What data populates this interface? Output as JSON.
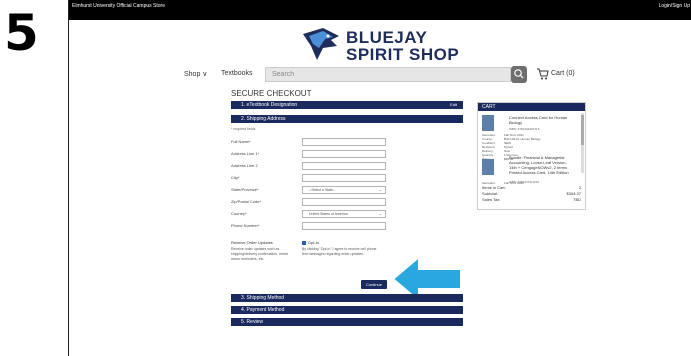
{
  "step_number": "5",
  "topbar": {
    "store": "Elmhurst University Official Campus Store",
    "login": "Login/Sign Up"
  },
  "logo": {
    "line1": "BLUEJAY",
    "line2": "SPIRIT SHOP"
  },
  "nav": {
    "shop": "Shop ∨",
    "textbooks": "Textbooks",
    "search_placeholder": "Search",
    "cart": "Cart (0)"
  },
  "page_title": "SECURE CHECKOUT",
  "sections": {
    "s1": "1. eTextbook Designation",
    "s1_edit": "Edit",
    "s2": "2. Shipping Address",
    "s3": "3. Shipping Method",
    "s4": "4. Payment Method",
    "s5": "5. Review"
  },
  "form": {
    "required_note": "* required fields",
    "fields": [
      {
        "label": "Full Name*",
        "value": ""
      },
      {
        "label": "Address Line 1*",
        "value": ""
      },
      {
        "label": "Address Line 2",
        "value": ""
      },
      {
        "label": "City*",
        "value": ""
      },
      {
        "label": "State/Province*",
        "value": "--Select a State--"
      },
      {
        "label": "Zip/Postal Code*",
        "value": ""
      },
      {
        "label": "Country*",
        "value": "United States of America"
      },
      {
        "label": "Phone Number*",
        "value": ""
      }
    ],
    "updates_title": "Receive Order Updates",
    "updates_desc": "Receive order updates such as shipping/delivery confirmation, rental return reminders, etc.",
    "optin_label": "Opt-in",
    "consent": "By clicking \"Opt-in\" I agree to receive cell phone text messages regarding order updates.",
    "continue": "Continue"
  },
  "cart": {
    "heading": "CART",
    "items": [
      {
        "name": "Connect Access Card for Human Biology",
        "isbn": "ISBN: 9781264462715",
        "meta": [
          [
            "Semester:",
            "Fall Term 2021"
          ],
          [
            "Course:",
            "BIO-100-01 Human Biology"
          ],
          [
            "Condition:",
            "NEW"
          ],
          [
            "Recipient:",
            "Myself"
          ],
          [
            "Delivery:",
            "Now"
          ],
          [
            "Quantity:",
            "1 Remove"
          ],
          [
            "Price:",
            "$68.40"
          ]
        ]
      },
      {
        "name": "Bundle: Financial & Managerial Accounting, Loose-Leaf Version, 14th + CengageNOWv2, 2 terms Printed Access Card, 14th Edition",
        "isbn": "ISBN: 9781337911610",
        "meta": [
          [
            "Semester:",
            "Fall Term 2021"
          ]
        ]
      }
    ],
    "items_in_cart_label": "Items in Cart:",
    "items_in_cart": "2",
    "subtotal_label": "Subtotal:",
    "subtotal": "$304.37",
    "tax_label": "Sales Tax:",
    "tax": "TBD"
  },
  "colors": {
    "navy": "#1a2a5e",
    "arrow": "#29a8df",
    "accent": "#2b5db8"
  }
}
